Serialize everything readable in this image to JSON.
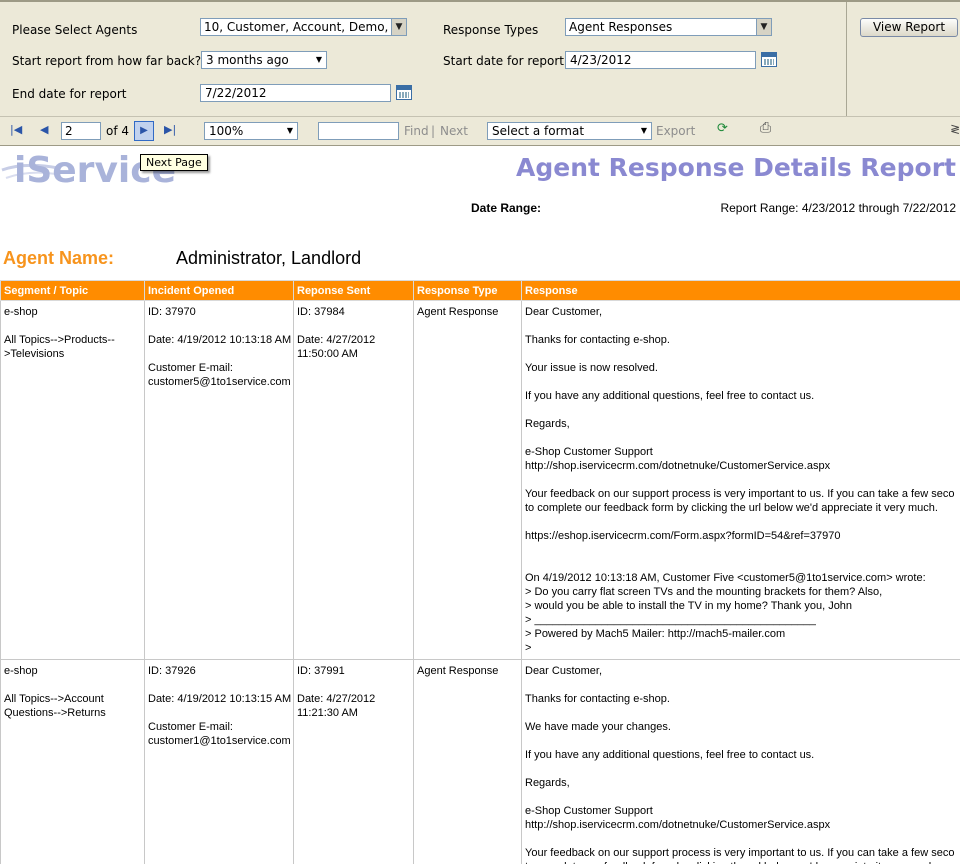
{
  "params": {
    "agents_label": "Please Select Agents",
    "agents_value": "10, Customer, Account, Demo, A",
    "response_types_label": "Response Types",
    "response_types_value": "Agent Responses",
    "how_far_back_label": "Start report from how far back?",
    "how_far_back_value": "3 months ago",
    "start_date_label": "Start date for report",
    "start_date_value": "4/23/2012",
    "end_date_label": "End date for report",
    "end_date_value": "7/22/2012",
    "view_report_label": "View Report"
  },
  "toolbar": {
    "page_current": "2",
    "page_of": "of 4",
    "zoom": "100%",
    "find_label": "Find",
    "find_separator": "|",
    "next_label": "Next",
    "format_placeholder": "Select a format",
    "export_label": "Export",
    "next_page_tooltip": "Next Page"
  },
  "report": {
    "logo_text": "iService",
    "title": "Agent Response Details Report",
    "date_range_label": "Date Range:",
    "date_range_value": "Report Range: 4/23/2012 through 7/22/2012",
    "agent_name_label": "Agent Name:",
    "agent_name_value": "Administrator, Landlord",
    "columns": [
      "Segment / Topic",
      "Incident Opened",
      "Reponse Sent",
      "Response Type",
      "Response"
    ],
    "rows": [
      {
        "segment": "e-shop",
        "topic_line1": "All Topics-->Products--",
        "topic_line2": ">Televisions",
        "incident_id": "ID: 37970",
        "incident_date": "Date: 4/19/2012 10:13:18 AM",
        "customer_email_label": "Customer E-mail:",
        "customer_email": "customer5@1to1service.com",
        "response_id": "ID: 37984",
        "response_date_line1": "Date: 4/27/2012",
        "response_date_line2": "11:50:00 AM",
        "response_type": "Agent Response",
        "response_lines": [
          "Dear Customer,",
          "",
          "Thanks for contacting e-shop.",
          "",
          "Your issue is now resolved.",
          "",
          "If you have any additional questions, feel free to contact us.",
          "",
          "Regards,",
          "",
          "e-Shop Customer Support",
          "http://shop.iservicecrm.com/dotnetnuke/CustomerService.aspx",
          "",
          "Your feedback on our support process is very important to us. If you can take a few seco",
          "to complete our feedback form by clicking the url below we'd appreciate it very much.",
          "",
          "https://eshop.iservicecrm.com/Form.aspx?formID=54&ref=37970",
          "",
          "",
          "On 4/19/2012 10:13:18 AM, Customer Five <customer5@1to1service.com> wrote:",
          "> Do you carry flat screen TVs and the mounting brackets for them? Also,",
          "> would you be able to install the TV in my home? Thank you, John",
          "> ______________________________________________",
          "> Powered by Mach5 Mailer: http://mach5-mailer.com",
          ">"
        ]
      },
      {
        "segment": "e-shop",
        "topic_line1": "All Topics-->Account",
        "topic_line2": "Questions-->Returns",
        "incident_id": "ID: 37926",
        "incident_date": "Date: 4/19/2012 10:13:15 AM",
        "customer_email_label": "Customer E-mail:",
        "customer_email": "customer1@1to1service.com",
        "response_id": "ID: 37991",
        "response_date_line1": "Date: 4/27/2012",
        "response_date_line2": "11:21:30 AM",
        "response_type": "Agent Response",
        "response_lines": [
          "Dear Customer,",
          "",
          "Thanks for contacting e-shop.",
          "",
          "We have made your changes.",
          "",
          "If you have any additional questions, feel free to contact us.",
          "",
          "Regards,",
          "",
          "e-Shop Customer Support",
          "http://shop.iservicecrm.com/dotnetnuke/CustomerService.aspx",
          "",
          "Your feedback on our support process is very important to us. If you can take a few seco",
          "to complete our feedback form by clicking the url below we'd appreciate it very much."
        ]
      }
    ]
  },
  "colors": {
    "accent_orange": "#ff8c00",
    "title_purple": "#8a89d1",
    "agent_label_orange": "#f7941d",
    "panel_bg": "#ece9d8"
  }
}
